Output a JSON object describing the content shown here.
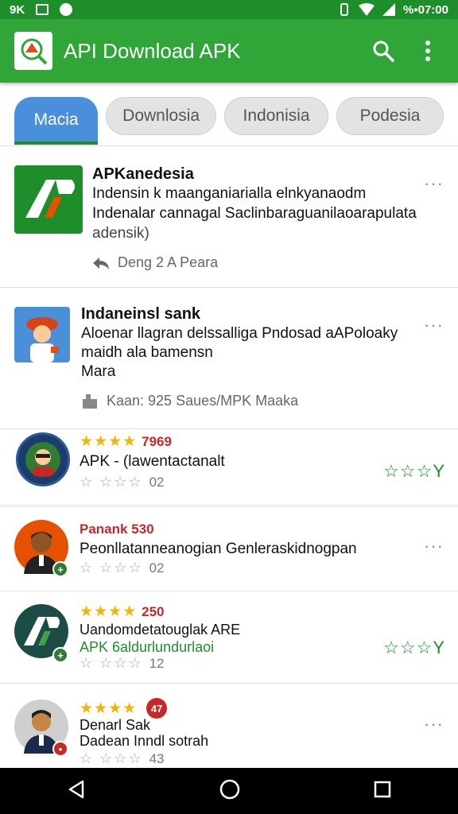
{
  "status_bar": {
    "left_text": "9K",
    "right_text": "%▪07:00"
  },
  "app_bar": {
    "title": "API Download APK"
  },
  "tabs": [
    {
      "label": "Macia",
      "active": true
    },
    {
      "label": "Downlosia",
      "active": false
    },
    {
      "label": "Indonisia",
      "active": false
    },
    {
      "label": "Podesia",
      "active": false
    }
  ],
  "items": [
    {
      "title": "APKanedesia",
      "lines": [
        "Indensin k  maanganiarialla elnkyanaodm",
        "Indenalar cannagal Saclinbaraguanilaoarapulata",
        "adensik)"
      ],
      "meta": "Deng 2 A Peara",
      "more": "···"
    },
    {
      "title": "Indaneinsl sank",
      "lines": [
        "Aloenar llagran delssalliga Pndosad aAPoloaky",
        "maidh ala bamensn",
        "Mara"
      ],
      "meta": "Kaan: 925 Saues/MPK Maaka",
      "more": "···"
    },
    {
      "stars": "★★★★",
      "rating": "7969",
      "lines": [
        "APK - (lawentactanalt"
      ],
      "empty_stars": "☆ ☆☆☆",
      "count": "02",
      "green_stars": "☆☆☆Y"
    },
    {
      "rating": "Panank 530",
      "lines": [
        "Peonllatanneanogian Genleraskidnogpan"
      ],
      "empty_stars": "☆ ☆☆☆",
      "count": "02",
      "more": "···"
    },
    {
      "stars": "★★★★",
      "rating": "250",
      "lines": [
        "Uandomdetatouglak ARE",
        "APK 6aldurlundurlaoi"
      ],
      "empty_stars": "☆ ☆☆☆",
      "count": "12",
      "green_stars": "☆☆☆Y"
    },
    {
      "stars": "★★★★",
      "badge": "47",
      "lines": [
        "Denarl Sak",
        "Dadean Inndl sotrah"
      ],
      "empty_stars": "☆ ☆☆☆",
      "count": "43",
      "more": "···"
    }
  ],
  "colors": {
    "app_bar": "#2fa637",
    "status_bar": "#1e8e2a",
    "active_tab": "#4a8fdc",
    "star": "#f4b400",
    "rating_red": "#c62828"
  }
}
